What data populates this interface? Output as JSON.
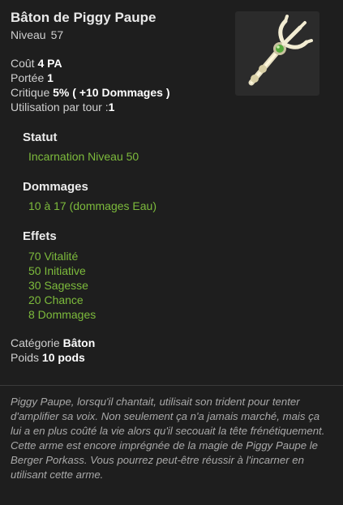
{
  "item": {
    "name": "Bâton de Piggy Paupe",
    "level_label": "Niveau",
    "level_value": "57"
  },
  "stats": {
    "cost_label": "Coût",
    "cost_value": "4 PA",
    "range_label": "Portée",
    "range_value": "1",
    "critical_label": "Critique",
    "critical_value": "5% ( +10 Dommages )",
    "uses_label": "Utilisation par tour :",
    "uses_value": "1"
  },
  "status": {
    "heading": "Statut",
    "value": "Incarnation Niveau 50"
  },
  "damage": {
    "heading": "Dommages",
    "value": "10 à 17 (dommages Eau)"
  },
  "effects": {
    "heading": "Effets",
    "items": [
      "70 Vitalité",
      "50 Initiative",
      "30 Sagesse",
      "20 Chance",
      "8 Dommages"
    ]
  },
  "category": {
    "label": "Catégorie",
    "value": "Bâton"
  },
  "weight": {
    "label": "Poids",
    "value": "10 pods"
  },
  "description": "Piggy Paupe, lorsqu'il chantait, utilisait son trident pour tenter d'amplifier sa voix. Non seulement ça n'a jamais marché, mais ça lui a en plus coûté la vie alors qu'il secouait la tête frénétiquement. Cette arme est encore imprégnée de la magie de Piggy Paupe le Berger Porkass. Vous pourrez peut-être réussir à l'incarner en utilisant cette arme.",
  "icon": "trident-staff-icon",
  "colors": {
    "effect_green": "#7dbb3c",
    "background": "#1e1e1e"
  }
}
